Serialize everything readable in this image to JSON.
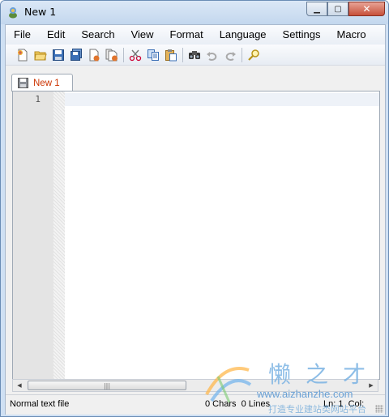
{
  "window": {
    "title": "New 1"
  },
  "menu": [
    "File",
    "Edit",
    "Search",
    "View",
    "Format",
    "Language",
    "Settings",
    "Macro"
  ],
  "toolbar": {
    "groups": [
      [
        "new-file-icon",
        "open-file-icon",
        "save-icon",
        "save-all-icon",
        "close-icon",
        "close-all-icon"
      ],
      [
        "cut-icon",
        "copy-icon",
        "paste-icon"
      ],
      [
        "find-icon",
        "undo-icon",
        "redo-icon"
      ],
      [
        "find-replace-icon"
      ]
    ]
  },
  "tab": {
    "label": "New 1"
  },
  "editor": {
    "line_number": "1"
  },
  "status": {
    "file_type": "Normal text file",
    "counts": "0 Chars  0 Lines",
    "position": "Ln: 1  Col:"
  },
  "watermark": {
    "chinese": "懒之才",
    "url": "www.aizhanzhe.com",
    "slogan": "打造专业建站类网站平台"
  },
  "colors": {
    "tab_text": "#cc3300",
    "gutter": "#e4e4e4",
    "titlebar": "#c3d7ee"
  }
}
